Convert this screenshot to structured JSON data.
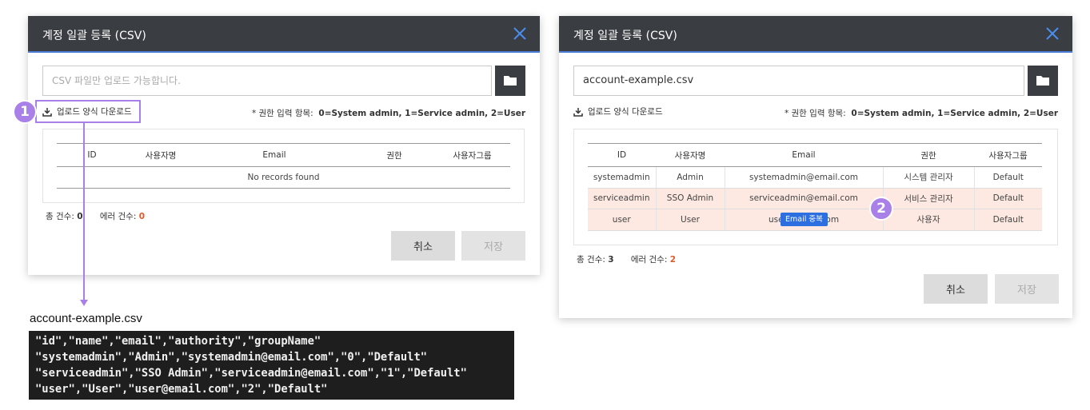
{
  "dialog_left": {
    "title": "계정 일괄 등록 (CSV)",
    "file_placeholder": "CSV 파일만 업로드 가능합니다.",
    "download_label": "업로드 양식 다운로드",
    "auth_note_prefix": "* 권한 입력 항목:",
    "auth_note_values": "0=System admin, 1=Service admin, 2=User",
    "columns": [
      "ID",
      "사용자명",
      "Email",
      "권한",
      "사용자그룹"
    ],
    "empty_text": "No records found",
    "total_label": "총 건수:",
    "total_value": "0",
    "error_label": "에러 건수:",
    "error_value": "0",
    "cancel_label": "취소",
    "save_label": "저장"
  },
  "dialog_right": {
    "title": "계정 일괄 등록 (CSV)",
    "file_value": "account-example.csv",
    "download_label": "업로드 양식 다운로드",
    "auth_note_prefix": "* 권한 입력 항목:",
    "auth_note_values": "0=System admin, 1=Service admin, 2=User",
    "columns": [
      "ID",
      "사용자명",
      "Email",
      "권한",
      "사용자그룹"
    ],
    "rows": [
      [
        "systemadmin",
        "Admin",
        "systemadmin@email.com",
        "시스템 관리자",
        "Default"
      ],
      [
        "serviceadmin",
        "SSO Admin",
        "serviceadmin@email.com",
        "서비스 관리자",
        "Default"
      ],
      [
        "user",
        "User",
        "user@email.com",
        "사용자",
        "Default"
      ]
    ],
    "tooltip": "Email 중복",
    "total_label": "총 건수:",
    "total_value": "3",
    "error_label": "에러 건수:",
    "error_value": "2",
    "cancel_label": "취소",
    "save_label": "저장"
  },
  "annotations": {
    "badge1": "1",
    "badge2": "2",
    "accent_color": "#a880e8"
  },
  "csv_example": {
    "filename": "account-example.csv",
    "lines": [
      "\"id\",\"name\",\"email\",\"authority\",\"groupName\"",
      "\"systemadmin\",\"Admin\",\"systemadmin@email.com\",\"0\",\"Default\"",
      "\"serviceadmin\",\"SSO Admin\",\"serviceadmin@email.com\",\"1\",\"Default\"",
      "\"user\",\"User\",\"user@email.com\",\"2\",\"Default\""
    ]
  },
  "colors": {
    "header_bg": "#3a3d42",
    "header_accent": "#4a7bd6",
    "error_row_bg": "#fde9e2",
    "error_count": "#e05a28",
    "tooltip_bg": "#2d6fe0"
  }
}
